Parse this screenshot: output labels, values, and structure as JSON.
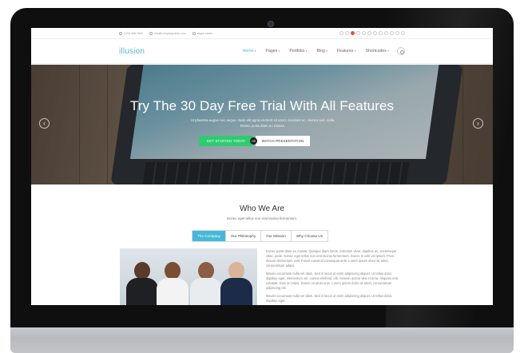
{
  "topbar": {
    "phone": "(123) 456-7890",
    "email": "info@companyname.com",
    "skype": "skype.name",
    "social_icons": [
      "facebook-icon",
      "twitter-icon",
      "google-plus-icon",
      "pinterest-icon",
      "linkedin-icon",
      "dribbble-icon",
      "flickr-icon",
      "instagram-icon",
      "vimeo-icon",
      "youtube-icon",
      "tumblr-icon",
      "rss-icon"
    ],
    "active_social_color": "#e5523b"
  },
  "nav": {
    "logo": "illusion",
    "items": [
      "Home",
      "Pages",
      "Portfolio",
      "Blog",
      "Features",
      "Shortcodes"
    ],
    "active_index": 0,
    "accent": "#4bb8dd"
  },
  "hero": {
    "title": "Try The 30 Day Free Trial With All Features",
    "text": "Ut pharetra augue nec augue. Nam elit agna,endrerit sit amet, tincidunt ac, viverra sed, nulla. Donec porta diam eu massa.",
    "or_label": "OR",
    "btn_start": "GET STARTED TODAY",
    "btn_watch": "WATCH PRESENTATION",
    "btn_start_color": "#2ecc71"
  },
  "about": {
    "title": "Who We Are",
    "subtitle": "Donec eget tellus non erat lacinia fermentum.",
    "tabs": [
      "The Company",
      "Our Philosophy",
      "Our Mission",
      "Why Choose Us"
    ],
    "active_tab": 0,
    "tab_accent": "#46b8da",
    "paragraphs": [
      "Donec porta diam eu massa. Quisque diam lorem, interdum vitae, dapibus ac, scelerisque vitae, pede. Donec eget tellus non erat lacinia fermentum. Donec in velit vel ipsum. Proin dictum elementum velit. Fusce euismod consequat ante. Lorem ipsum dolor sit amet, consectetuer adipis.",
      "Mauris accumsan nulla vel diam. Sed in lacus ut enim adipiscing aliquet. Ut tellus dolor, dapibus eget, elementum vel, cursus eleifend, elit. Aenean auctor wisi et urna. Aliquam erat volutpat. Duis ac turpis. Donec sit amet eros. Lorem ipsum dolor sit amet, consectetuer adipiscing elit.",
      "Mauris accumsan nulla vel diam. Sed in lacus ut enim adipiscing aliquet. Ut tellus dolor, dapibus eget."
    ]
  }
}
